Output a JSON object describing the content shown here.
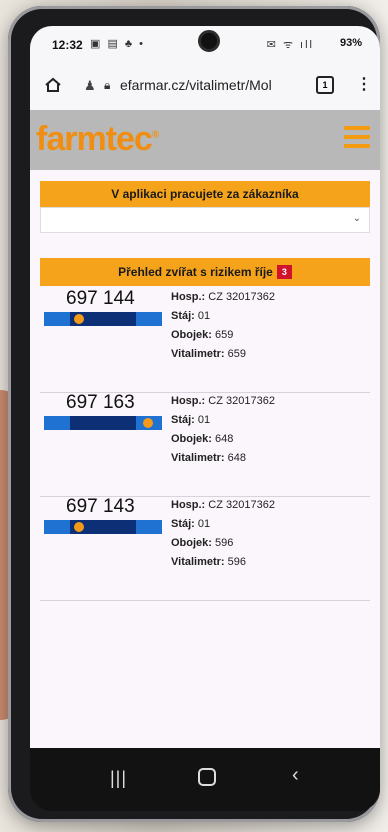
{
  "statusbar": {
    "time": "12:32",
    "battery": "93%"
  },
  "browser": {
    "url": "efarmar.cz/vitalimetr/Mol",
    "tab_count": "1"
  },
  "app": {
    "logo_text": "farmtec",
    "logo_mark": "®"
  },
  "customer": {
    "banner": "V aplikaci pracujete za zákazníka",
    "selected": ""
  },
  "risk": {
    "title": "Přehled zvířat s rizikem říje",
    "count": "3"
  },
  "labels": {
    "hosp": "Hosp.:",
    "staj": "Stáj:",
    "obojek": "Obojek:",
    "vitalimetr": "Vitalimetr:"
  },
  "animals": [
    {
      "id": "697 144",
      "hosp": "CZ 32017362",
      "staj": "01",
      "obojek": "659",
      "vitalimetr": "659",
      "level": 0.28
    },
    {
      "id": "697 163",
      "hosp": "CZ 32017362",
      "staj": "01",
      "obojek": "648",
      "vitalimetr": "648",
      "level": 0.92
    },
    {
      "id": "697 143",
      "hosp": "CZ 32017362",
      "staj": "01",
      "obojek": "596",
      "vitalimetr": "596",
      "level": 0.28
    }
  ],
  "colors": {
    "accent": "#f5a31b",
    "badge": "#d1122a",
    "bar_dark": "#0c2f75",
    "bar_light": "#1f72d1"
  }
}
